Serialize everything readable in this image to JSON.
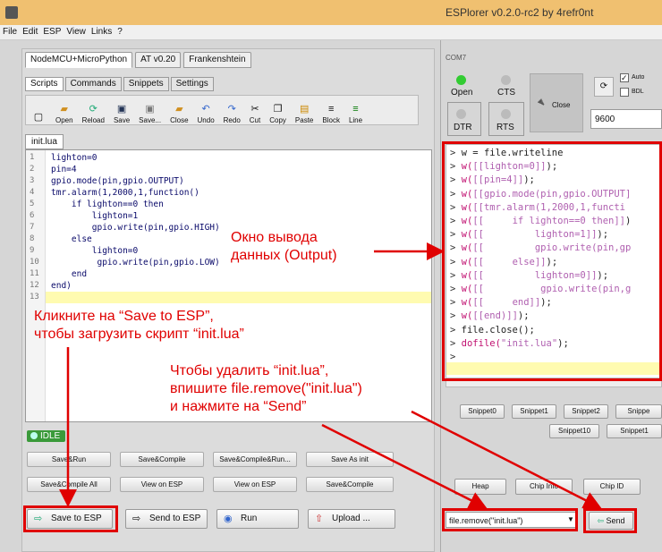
{
  "window": {
    "title": "ESPlorer v0.2.0-rc2 by 4refr0nt"
  },
  "menu": [
    "File",
    "Edit",
    "ESP",
    "View",
    "Links",
    "?"
  ],
  "left_tabs": [
    "NodeMCU+MicroPython",
    "AT v0.20",
    "Frankenshtein"
  ],
  "sub_tabs": [
    "Scripts",
    "Commands",
    "Snippets",
    "Settings"
  ],
  "toolbar": [
    "Open",
    "Reload",
    "Save",
    "Save...",
    "Close",
    "Undo",
    "Redo",
    "Cut",
    "Copy",
    "Paste",
    "Block",
    "Line"
  ],
  "file_tab": "init.lua",
  "code_lines": [
    "lighton=0",
    "pin=4",
    "gpio.mode(pin,gpio.OUTPUT)",
    "tmr.alarm(1,2000,1,function()",
    "    if lighton==0 then",
    "        lighton=1",
    "        gpio.write(pin,gpio.HIGH)",
    "    else",
    "        lighton=0",
    "         gpio.write(pin,gpio.LOW)",
    "    end",
    "end)",
    ""
  ],
  "status": "IDLE",
  "buttons_row1": [
    "Save&Run",
    "Save&Compile",
    "Save&Compile&Run...",
    "Save As init"
  ],
  "buttons_row2": [
    "Save&Compile All",
    "View on ESP",
    "View on ESP",
    "Save&Compile"
  ],
  "bottom_buttons": {
    "save_esp": "Save to ESP",
    "send_esp": "Send to ESP",
    "run": "Run",
    "upload": "Upload ..."
  },
  "port": {
    "name": "COM7",
    "open": "Open",
    "cts": "CTS",
    "close": "Close",
    "dtr": "DTR",
    "rts": "RTS",
    "baud": "9600",
    "auto": "Auto",
    "bdl": "BDL"
  },
  "output_lines": [
    {
      "p": ">",
      "t": "w = file.writeline"
    },
    {
      "p": ">",
      "f": "w(",
      "s": "[[lighton=0]]",
      "e": ");"
    },
    {
      "p": ">",
      "f": "w(",
      "s": "[[pin=4]]",
      "e": ");"
    },
    {
      "p": ">",
      "f": "w(",
      "s": "[[gpio.mode(pin,gpio.OUTPUT]",
      "e": ""
    },
    {
      "p": ">",
      "f": "w(",
      "s": "[[tmr.alarm(1,2000,1,functi",
      "e": ""
    },
    {
      "p": ">",
      "f": "w(",
      "s": "[[     if lighton==0 then]]",
      "e": ")"
    },
    {
      "p": ">",
      "f": "w(",
      "s": "[[         lighton=1]]",
      "e": ");"
    },
    {
      "p": ">",
      "f": "w(",
      "s": "[[         gpio.write(pin,gp",
      "e": ""
    },
    {
      "p": ">",
      "f": "w(",
      "s": "[[     else]]",
      "e": ");"
    },
    {
      "p": ">",
      "f": "w(",
      "s": "[[         lighton=0]]",
      "e": ");"
    },
    {
      "p": ">",
      "f": "w(",
      "s": "[[          gpio.write(pin,g",
      "e": ""
    },
    {
      "p": ">",
      "f": "w(",
      "s": "[[     end]]",
      "e": ");"
    },
    {
      "p": ">",
      "f": "w(",
      "s": "[[end)]]",
      "e": ");"
    },
    {
      "p": ">",
      "t": "file.close();"
    },
    {
      "p": ">",
      "f": "dofile(",
      "s": "\"init.lua\"",
      "e": ");"
    },
    {
      "p": ">",
      "t": ""
    }
  ],
  "snippets": [
    "Snippet0",
    "Snippet1",
    "Snippet2",
    "Snippe",
    "Snippet10",
    "Snippet1"
  ],
  "right_buttons": {
    "heap": "Heap",
    "chip_info": "Chip Info",
    "chip_id": "Chip ID",
    "send": "Send"
  },
  "command_input": "file.remove(\"init.lua\")",
  "annotations": {
    "output": "Окно вывода\nданных (Output)",
    "save": "Кликните на “Save to ESP”,\nчтобы загрузить скрипт “init.lua”",
    "remove": "Чтобы удалить “init.lua”,\nвпишите file.remove(\"init.lua\")\nи нажмите на “Send”"
  }
}
